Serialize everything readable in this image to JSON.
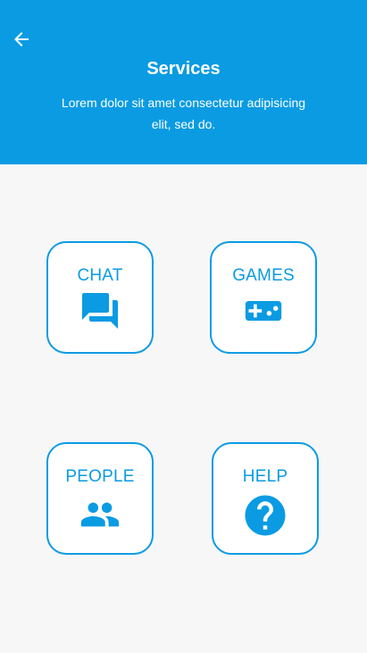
{
  "header": {
    "title": "Services",
    "subtitle": "Lorem dolor sit amet consectetur adipisicing elit, sed do."
  },
  "nav": {
    "back_icon": "arrow-left-icon"
  },
  "services": [
    {
      "label": "CHAT",
      "icon": "chat-icon"
    },
    {
      "label": "GAMES",
      "icon": "gamepad-icon"
    },
    {
      "label": "PEOPLE",
      "icon": "people-icon"
    },
    {
      "label": "HELP",
      "icon": "help-icon"
    }
  ],
  "colors": {
    "accent": "#0a9be3",
    "background": "#f7f7f7",
    "card_background": "#ffffff"
  }
}
